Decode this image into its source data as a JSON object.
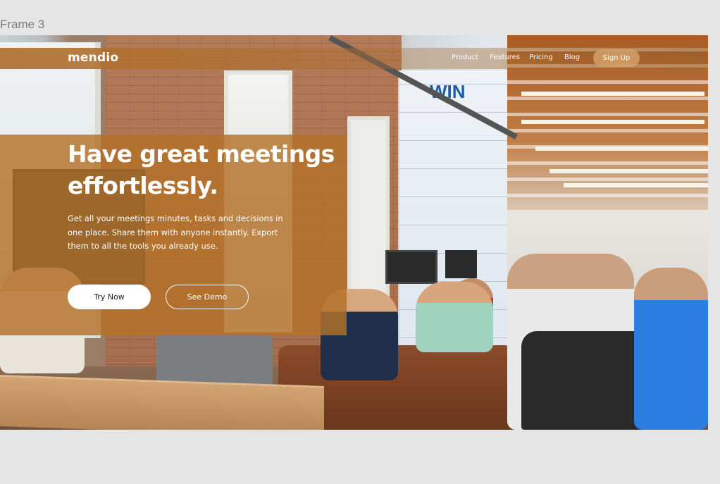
{
  "frame": {
    "label": "Frame 3"
  },
  "header": {
    "logo": "mendio",
    "nav": [
      {
        "label": "Product"
      },
      {
        "label": "Features"
      },
      {
        "label": "Pricing"
      },
      {
        "label": "Blog"
      }
    ],
    "signup_label": "Sign Up"
  },
  "hero": {
    "headline_line1": "Have great meetings",
    "headline_line2": "effortlessly.",
    "subcopy": "Get all your meetings minutes, tasks and decisions in one place. Share them with anyone instantly. Export them to all the tools you already use.",
    "primary_cta": "Try Now",
    "secondary_cta": "See Demo"
  },
  "background_image": {
    "wall_sign": "WIN"
  },
  "colors": {
    "accent": "#b47128",
    "text_on_accent": "#ffffff",
    "canvas": "#e5e5e5"
  }
}
